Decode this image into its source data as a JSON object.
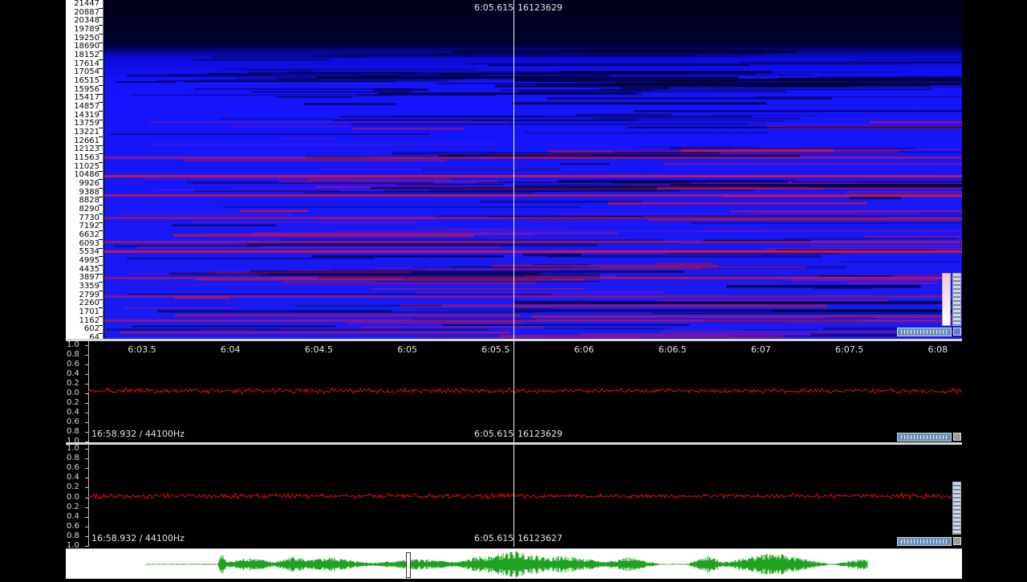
{
  "spectrogram": {
    "freq_labels": [
      "21447",
      "20887",
      "20348",
      "19789",
      "19250",
      "18690",
      "18152",
      "17614",
      "17054",
      "16515",
      "15956",
      "15417",
      "14857",
      "14319",
      "13759",
      "13221",
      "12661",
      "12123",
      "11563",
      "11025",
      "10486",
      "9926",
      "9388",
      "8828",
      "8290",
      "7730",
      "7192",
      "6632",
      "6093",
      "5534",
      "4995",
      "4435",
      "3897",
      "3359",
      "2799",
      "2260",
      "1701",
      "1162",
      "602",
      "64"
    ],
    "cursor_time": "6:05.615",
    "cursor_sample": "16123629"
  },
  "timeline": {
    "labels": [
      "6:03.5",
      "6:04",
      "6:04.5",
      "6:05",
      "6:05.5",
      "6:06",
      "6:06.5",
      "6:07",
      "6:07.5",
      "6:08"
    ]
  },
  "channel1": {
    "amp_labels": [
      "1.0",
      "0.8",
      "0.6",
      "0.4",
      "0.2",
      "0.0",
      "0.2",
      "0.4",
      "0.6",
      "0.8",
      "1.0"
    ],
    "info": "16:58.932 / 44100Hz",
    "cursor_time": "6:05.615",
    "cursor_sample": "16123629"
  },
  "channel2": {
    "amp_labels": [
      "1.0",
      "0.8",
      "0.6",
      "0.4",
      "0.2",
      "0.0",
      "0.2",
      "0.4",
      "0.6",
      "0.8",
      "1.0"
    ],
    "info": "16:58.932 / 44100Hz",
    "cursor_time": "6:05.615",
    "cursor_sample": "16123627"
  },
  "colors": {
    "waveform": "#e01010",
    "overview_wave": "#1fa21f",
    "spectrum_low": "#0a0a55",
    "spectrum_mid": "#1a1aff",
    "spectrum_high": "#ff1a1a"
  }
}
